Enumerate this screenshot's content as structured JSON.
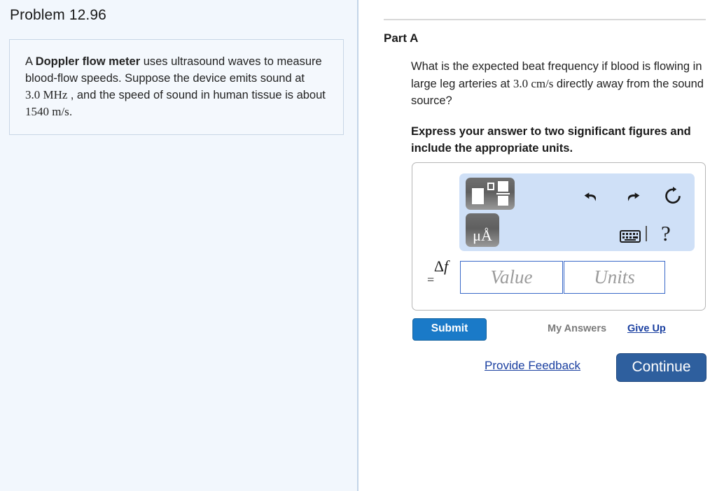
{
  "left": {
    "problem_title": "Problem 12.96",
    "statement": {
      "lead": "A ",
      "bold": "Doppler flow meter",
      "part1": " uses ultrasound waves to measure blood-flow speeds. Suppose the device emits sound at ",
      "freq_value": "3.0",
      "freq_unit": "MHz",
      "part2": ", and the speed of sound in human tissue is about ",
      "speed_value": "1540",
      "speed_unit_num": "m",
      "speed_unit_slash": "/",
      "speed_unit_den": "s",
      "period": "."
    }
  },
  "right": {
    "part_label": "Part A",
    "question": {
      "part1": "What is the expected beat frequency if blood is flowing in large leg arteries at ",
      "speed_value": "3.0",
      "speed_unit_num": "cm",
      "speed_unit_slash": "/",
      "speed_unit_den": "s",
      "part2": " directly away from the sound source?"
    },
    "instruction": "Express your answer to two significant figures and include the appropriate units.",
    "answer": {
      "lhs_delta": "Δ",
      "lhs_symbol": "f",
      "lhs_equals": "=",
      "value_placeholder": "Value",
      "units_placeholder": "Units"
    },
    "toolbar": {
      "template_button_label": "template-chooser",
      "units_button_label": "μÅ",
      "undo_label": "Undo",
      "redo_label": "Redo",
      "reset_label": "Reset",
      "keyboard_label": "Keyboard shortcuts",
      "help_label": "?"
    },
    "actions": {
      "submit_label": "Submit",
      "my_answers_label": "My Answers",
      "give_up_label": "Give Up",
      "provide_feedback_label": "Provide Feedback",
      "continue_label": "Continue"
    }
  },
  "colors": {
    "left_panel_bg": "#f2f7fd",
    "divider": "#c3d4e8",
    "math_toolbar_bg": "#cfe0f7",
    "field_border": "#3a69c8",
    "submit_bg": "#1a7ac8",
    "continue_bg": "#2e5f9e",
    "link": "#1a3fa0",
    "muted_text": "#7b7b7b"
  }
}
